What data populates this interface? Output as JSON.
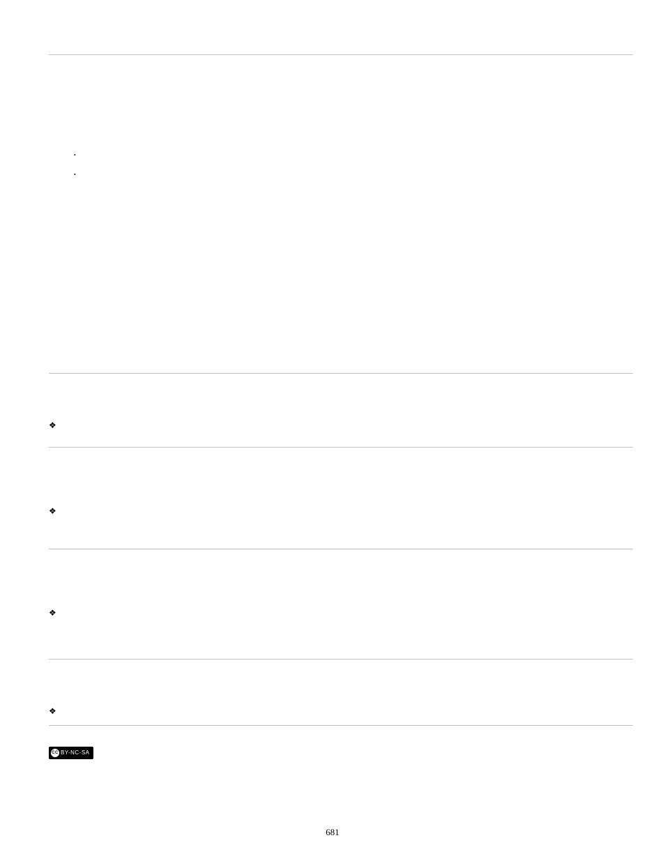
{
  "bullets": {
    "dot": "•",
    "diamond": "❖"
  },
  "cc_badge": {
    "cc": "CC",
    "text": "BY-NC-SA"
  },
  "page_number": "681"
}
